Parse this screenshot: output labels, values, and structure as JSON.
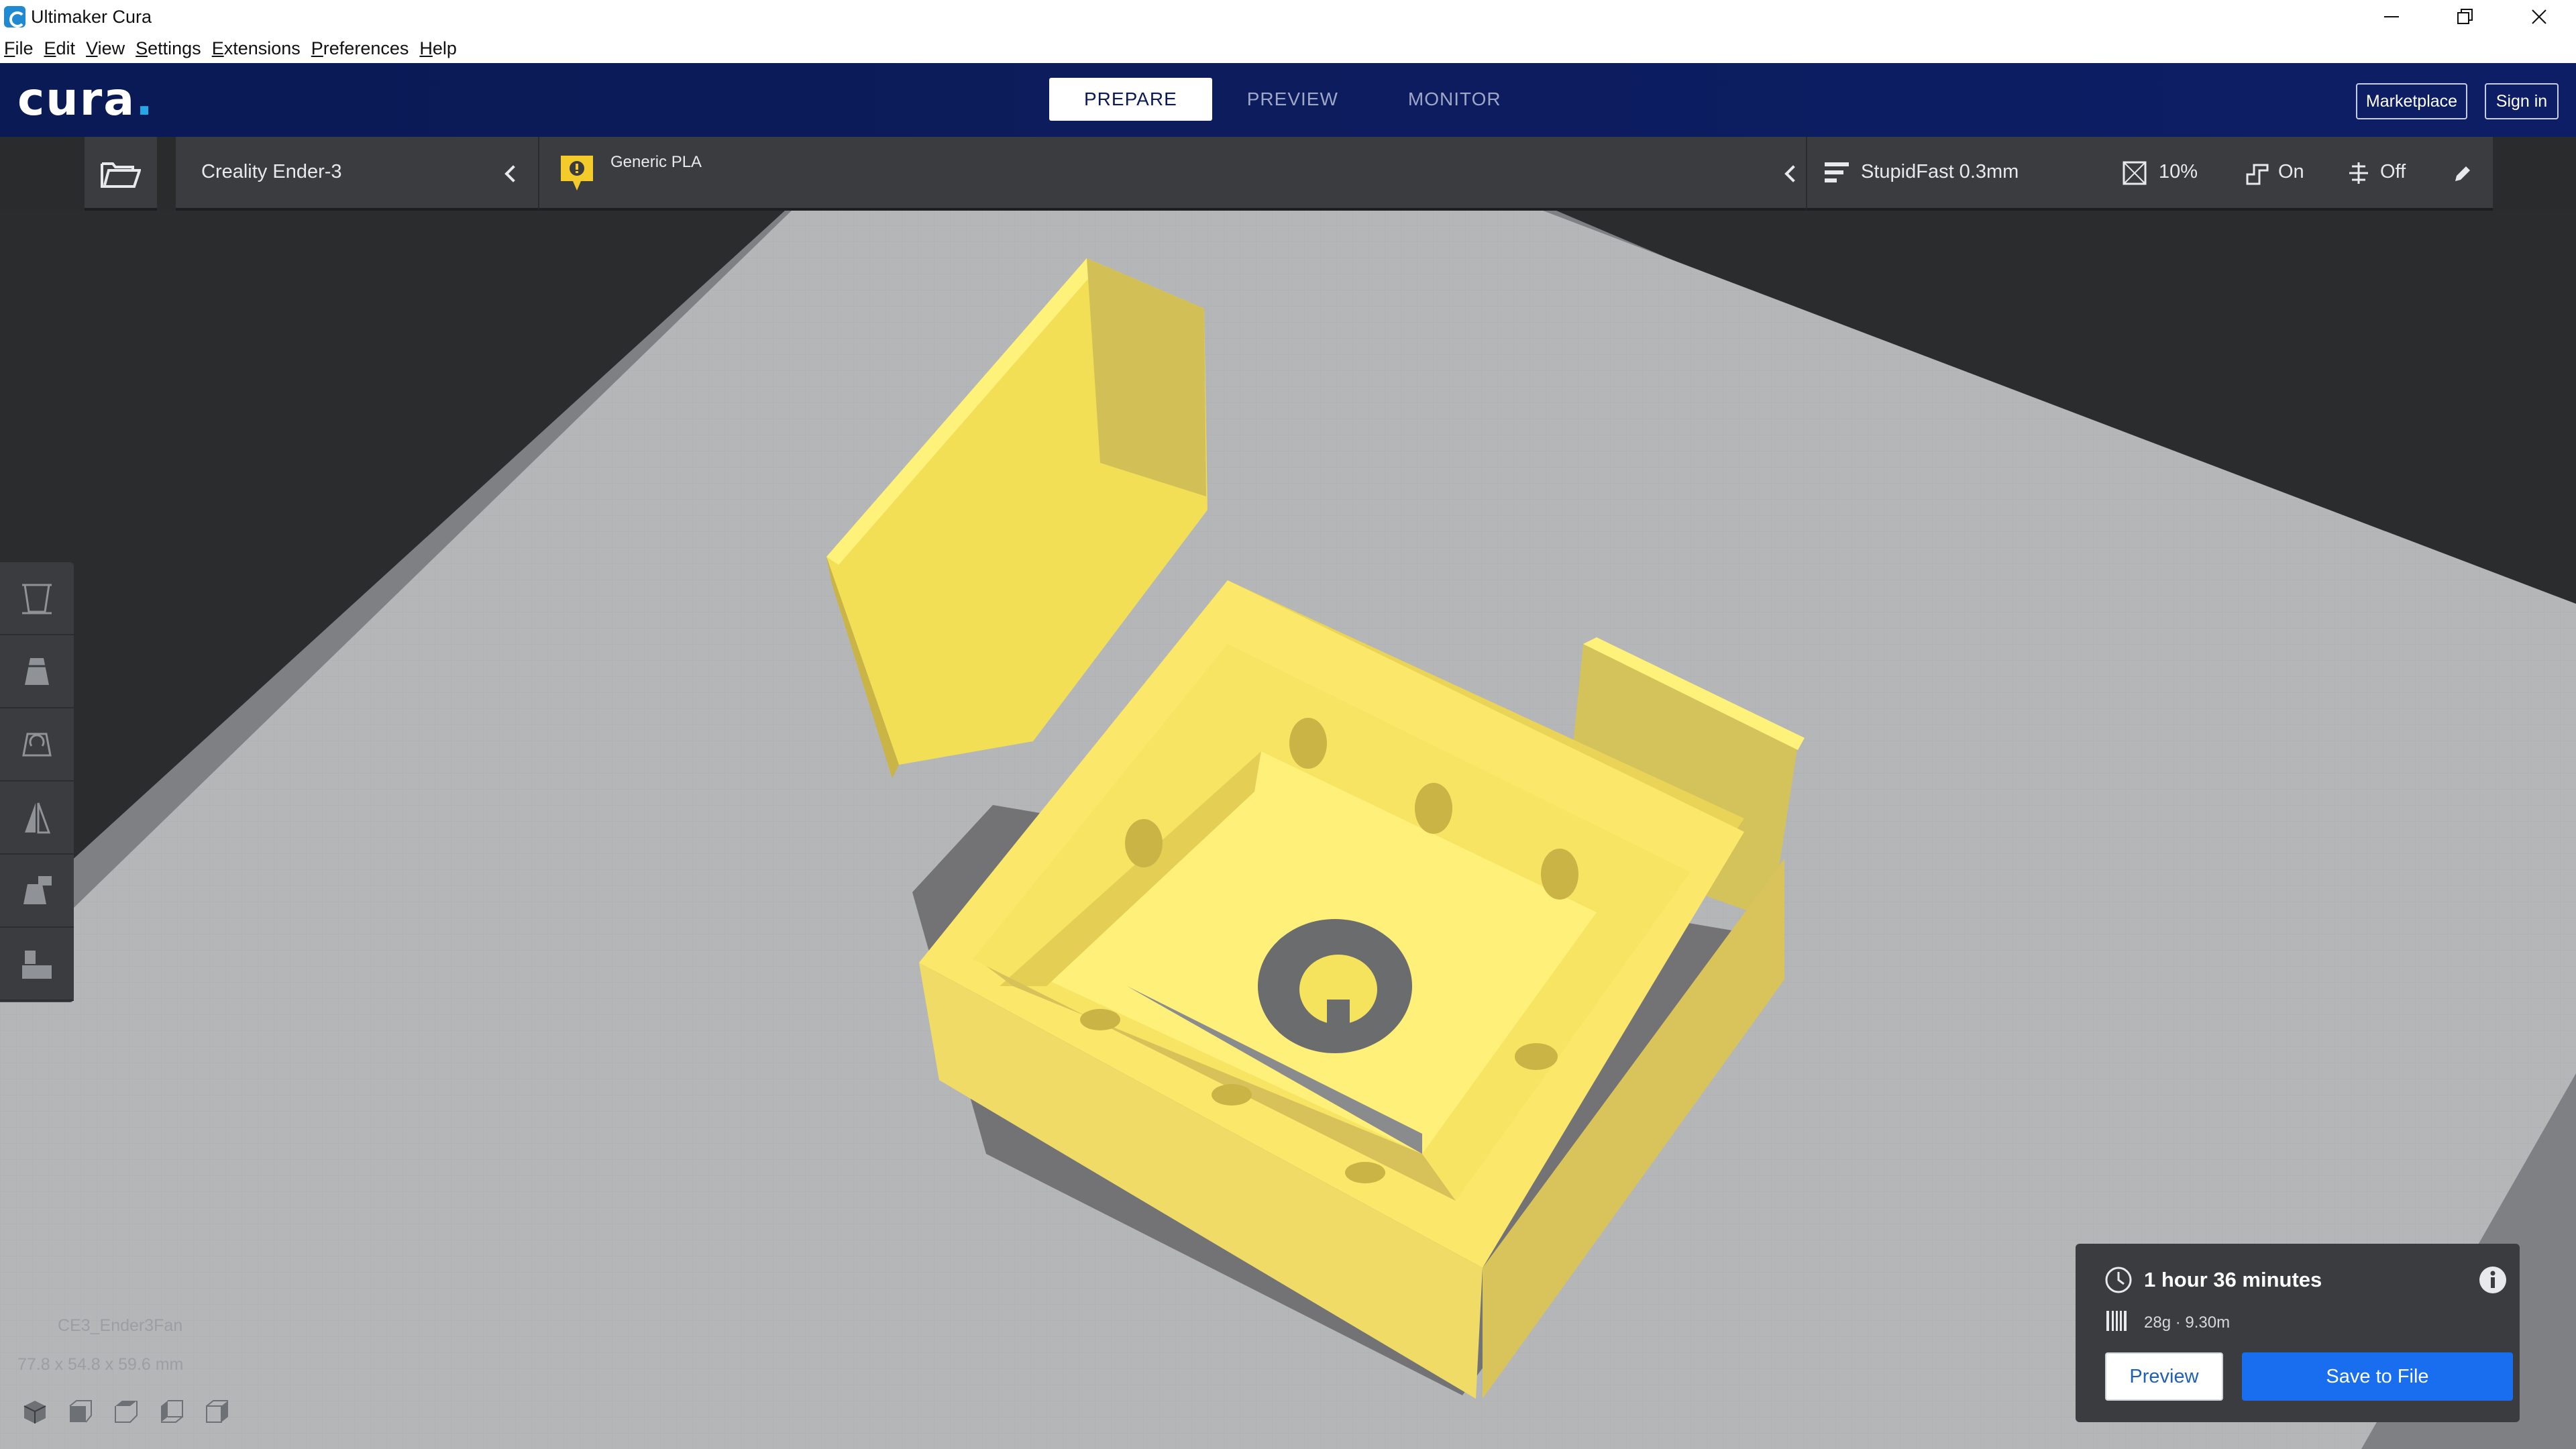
{
  "window": {
    "title": "Ultimaker Cura",
    "controls": [
      "minimize-icon",
      "restore-icon",
      "close-icon"
    ]
  },
  "menu": [
    "File",
    "Edit",
    "View",
    "Settings",
    "Extensions",
    "Preferences",
    "Help"
  ],
  "header": {
    "logo": "cura",
    "logo_dot": ".",
    "tabs": [
      "PREPARE",
      "PREVIEW",
      "MONITOR"
    ],
    "active_tab": "PREPARE",
    "marketplace_label": "Marketplace",
    "signin_label": "Sign in"
  },
  "toolbar": {
    "printer": "Creality Ender-3",
    "material": "Generic PLA",
    "profile": "StupidFast 0.3mm",
    "infill": "10%",
    "support": "On",
    "adhesion": "Off"
  },
  "left_tools": [
    "move-icon",
    "scale-icon",
    "rotate-icon",
    "mirror-icon",
    "per-model-settings-icon",
    "support-blocker-icon"
  ],
  "object": {
    "name": "CE3_Ender3Fan",
    "dimensions": "77.8 x 54.8 x 59.6 mm"
  },
  "view_buttons": [
    "view-3d-icon",
    "view-front-icon",
    "view-top-icon",
    "view-left-icon",
    "view-right-icon"
  ],
  "summary": {
    "time": "1 hour 36 minutes",
    "material_usage": "28g · 9.30m",
    "preview_label": "Preview",
    "save_label": "Save to File"
  },
  "colors": {
    "header_bg": "#0c1c5d",
    "accent_blue": "#196ef0",
    "model_yellow": "#f5e35e",
    "buildplate": "#b4b5b6"
  }
}
